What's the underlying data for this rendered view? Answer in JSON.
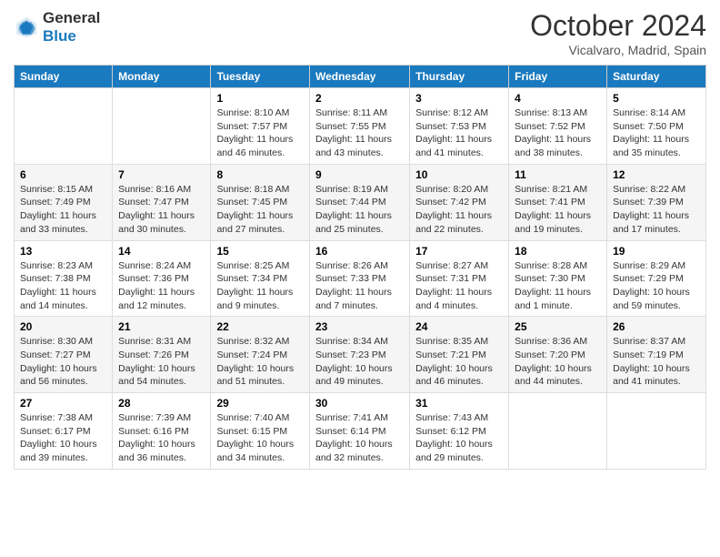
{
  "header": {
    "logo_line1": "General",
    "logo_line2": "Blue",
    "month": "October 2024",
    "location": "Vicalvaro, Madrid, Spain"
  },
  "days_of_week": [
    "Sunday",
    "Monday",
    "Tuesday",
    "Wednesday",
    "Thursday",
    "Friday",
    "Saturday"
  ],
  "weeks": [
    [
      {
        "day": "",
        "info": ""
      },
      {
        "day": "",
        "info": ""
      },
      {
        "day": "1",
        "info": "Sunrise: 8:10 AM\nSunset: 7:57 PM\nDaylight: 11 hours and 46 minutes."
      },
      {
        "day": "2",
        "info": "Sunrise: 8:11 AM\nSunset: 7:55 PM\nDaylight: 11 hours and 43 minutes."
      },
      {
        "day": "3",
        "info": "Sunrise: 8:12 AM\nSunset: 7:53 PM\nDaylight: 11 hours and 41 minutes."
      },
      {
        "day": "4",
        "info": "Sunrise: 8:13 AM\nSunset: 7:52 PM\nDaylight: 11 hours and 38 minutes."
      },
      {
        "day": "5",
        "info": "Sunrise: 8:14 AM\nSunset: 7:50 PM\nDaylight: 11 hours and 35 minutes."
      }
    ],
    [
      {
        "day": "6",
        "info": "Sunrise: 8:15 AM\nSunset: 7:49 PM\nDaylight: 11 hours and 33 minutes."
      },
      {
        "day": "7",
        "info": "Sunrise: 8:16 AM\nSunset: 7:47 PM\nDaylight: 11 hours and 30 minutes."
      },
      {
        "day": "8",
        "info": "Sunrise: 8:18 AM\nSunset: 7:45 PM\nDaylight: 11 hours and 27 minutes."
      },
      {
        "day": "9",
        "info": "Sunrise: 8:19 AM\nSunset: 7:44 PM\nDaylight: 11 hours and 25 minutes."
      },
      {
        "day": "10",
        "info": "Sunrise: 8:20 AM\nSunset: 7:42 PM\nDaylight: 11 hours and 22 minutes."
      },
      {
        "day": "11",
        "info": "Sunrise: 8:21 AM\nSunset: 7:41 PM\nDaylight: 11 hours and 19 minutes."
      },
      {
        "day": "12",
        "info": "Sunrise: 8:22 AM\nSunset: 7:39 PM\nDaylight: 11 hours and 17 minutes."
      }
    ],
    [
      {
        "day": "13",
        "info": "Sunrise: 8:23 AM\nSunset: 7:38 PM\nDaylight: 11 hours and 14 minutes."
      },
      {
        "day": "14",
        "info": "Sunrise: 8:24 AM\nSunset: 7:36 PM\nDaylight: 11 hours and 12 minutes."
      },
      {
        "day": "15",
        "info": "Sunrise: 8:25 AM\nSunset: 7:34 PM\nDaylight: 11 hours and 9 minutes."
      },
      {
        "day": "16",
        "info": "Sunrise: 8:26 AM\nSunset: 7:33 PM\nDaylight: 11 hours and 7 minutes."
      },
      {
        "day": "17",
        "info": "Sunrise: 8:27 AM\nSunset: 7:31 PM\nDaylight: 11 hours and 4 minutes."
      },
      {
        "day": "18",
        "info": "Sunrise: 8:28 AM\nSunset: 7:30 PM\nDaylight: 11 hours and 1 minute."
      },
      {
        "day": "19",
        "info": "Sunrise: 8:29 AM\nSunset: 7:29 PM\nDaylight: 10 hours and 59 minutes."
      }
    ],
    [
      {
        "day": "20",
        "info": "Sunrise: 8:30 AM\nSunset: 7:27 PM\nDaylight: 10 hours and 56 minutes."
      },
      {
        "day": "21",
        "info": "Sunrise: 8:31 AM\nSunset: 7:26 PM\nDaylight: 10 hours and 54 minutes."
      },
      {
        "day": "22",
        "info": "Sunrise: 8:32 AM\nSunset: 7:24 PM\nDaylight: 10 hours and 51 minutes."
      },
      {
        "day": "23",
        "info": "Sunrise: 8:34 AM\nSunset: 7:23 PM\nDaylight: 10 hours and 49 minutes."
      },
      {
        "day": "24",
        "info": "Sunrise: 8:35 AM\nSunset: 7:21 PM\nDaylight: 10 hours and 46 minutes."
      },
      {
        "day": "25",
        "info": "Sunrise: 8:36 AM\nSunset: 7:20 PM\nDaylight: 10 hours and 44 minutes."
      },
      {
        "day": "26",
        "info": "Sunrise: 8:37 AM\nSunset: 7:19 PM\nDaylight: 10 hours and 41 minutes."
      }
    ],
    [
      {
        "day": "27",
        "info": "Sunrise: 7:38 AM\nSunset: 6:17 PM\nDaylight: 10 hours and 39 minutes."
      },
      {
        "day": "28",
        "info": "Sunrise: 7:39 AM\nSunset: 6:16 PM\nDaylight: 10 hours and 36 minutes."
      },
      {
        "day": "29",
        "info": "Sunrise: 7:40 AM\nSunset: 6:15 PM\nDaylight: 10 hours and 34 minutes."
      },
      {
        "day": "30",
        "info": "Sunrise: 7:41 AM\nSunset: 6:14 PM\nDaylight: 10 hours and 32 minutes."
      },
      {
        "day": "31",
        "info": "Sunrise: 7:43 AM\nSunset: 6:12 PM\nDaylight: 10 hours and 29 minutes."
      },
      {
        "day": "",
        "info": ""
      },
      {
        "day": "",
        "info": ""
      }
    ]
  ]
}
